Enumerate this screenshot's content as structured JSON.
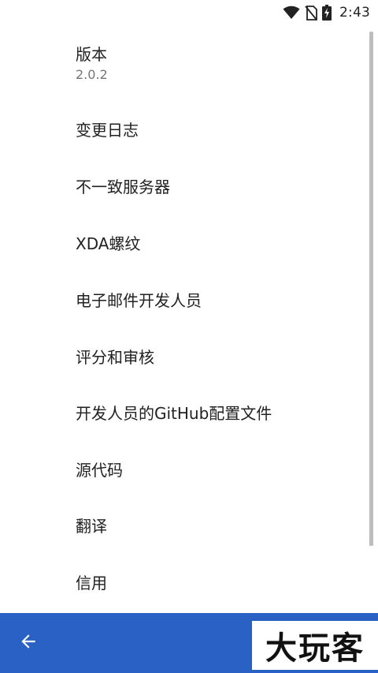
{
  "status_bar": {
    "time": "2:43",
    "icons": [
      "wifi-icon",
      "no-sim-icon",
      "battery-charging-icon"
    ]
  },
  "about_list": {
    "items": [
      {
        "title": "版本",
        "summary": "2.0.2"
      },
      {
        "title": "变更日志"
      },
      {
        "title": "不一致服务器"
      },
      {
        "title": "XDA螺纹"
      },
      {
        "title": "电子邮件开发人员"
      },
      {
        "title": "评分和审核"
      },
      {
        "title": "开发人员的GitHub配置文件"
      },
      {
        "title": "源代码"
      },
      {
        "title": "翻译"
      },
      {
        "title": "信用"
      }
    ]
  },
  "bottom_bar": {
    "back_icon": "arrow-left-icon",
    "watermark": "大玩客",
    "color": "#2962c4"
  }
}
